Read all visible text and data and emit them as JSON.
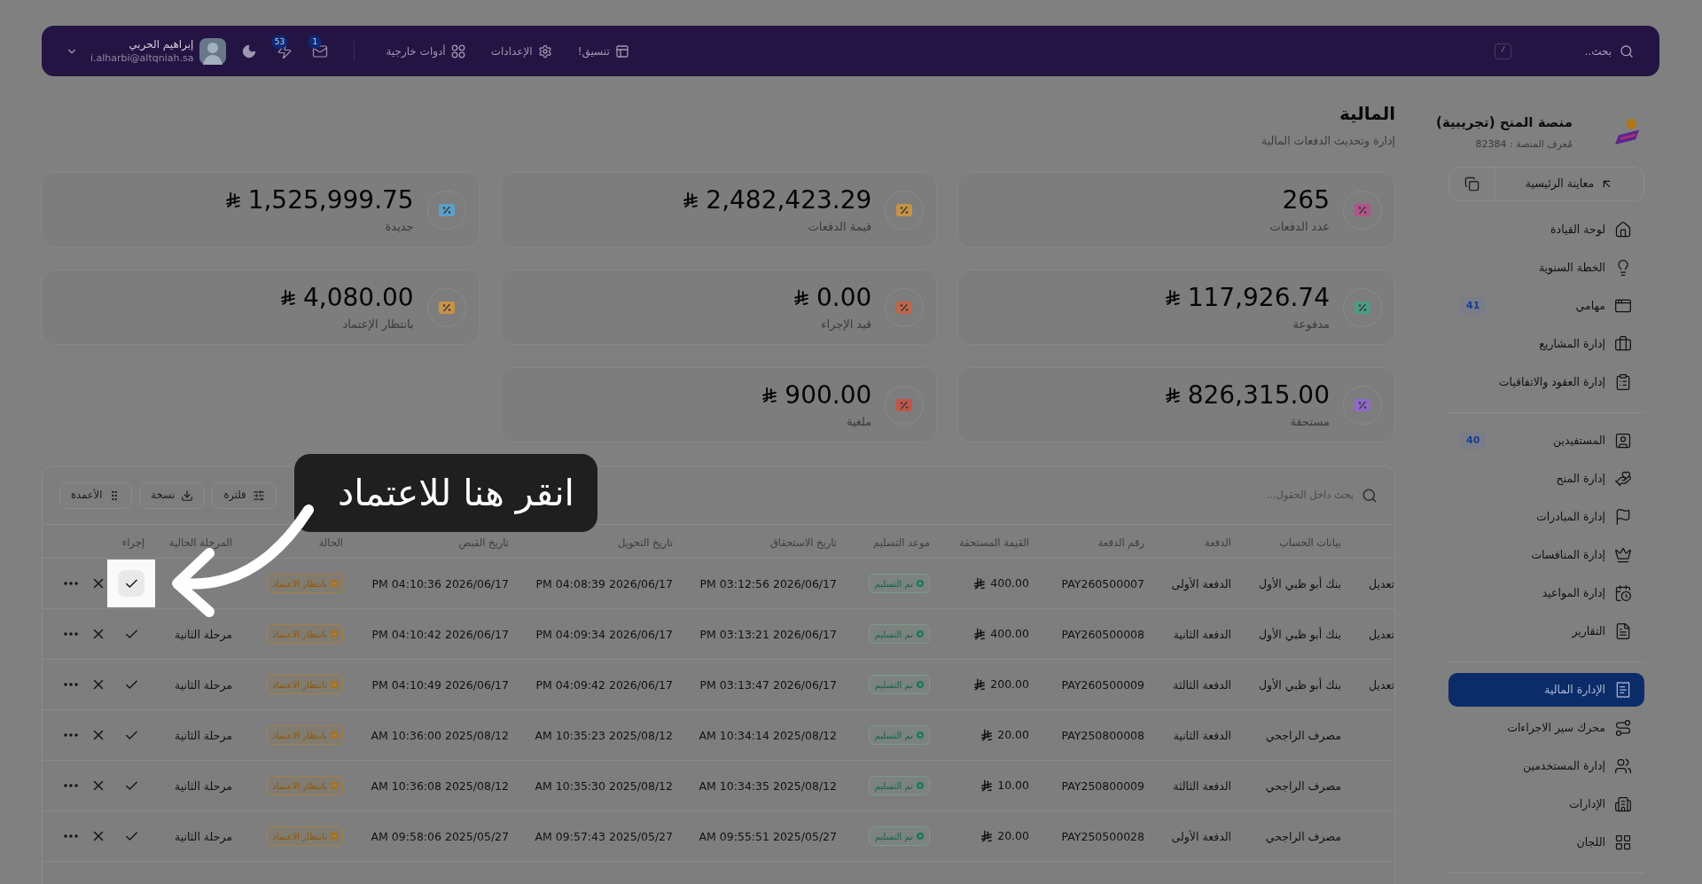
{
  "top_bar": {
    "search": {
      "placeholder": "بحث..",
      "shortcut": "/"
    },
    "links": [
      {
        "label": "تنسيق!"
      },
      {
        "label": "الإعدادات"
      },
      {
        "label": "أدوات خارجية"
      }
    ],
    "notifications": [
      {
        "count": "1"
      },
      {
        "count": "53"
      }
    ],
    "user": {
      "name": "إبراهيم الحربي",
      "email": "i.alharbi@altqniah.sa"
    }
  },
  "sidebar": {
    "platform": {
      "name": "منصة المنح (تجريبية)",
      "id_label": "مُعرف المنصة : 82384"
    },
    "preview_button": {
      "label": "معاينة الرئيسية"
    },
    "groups": [
      {
        "items": [
          {
            "label": "لوحة القيادة",
            "selected": false
          },
          {
            "label": "الخطة السنوية",
            "selected": false
          },
          {
            "label": "مهامي",
            "selected": false,
            "badge": "41"
          },
          {
            "label": "إدارة المشاريع",
            "selected": false
          },
          {
            "label": "إدارة العقود والاتفاقيات",
            "selected": false
          }
        ]
      },
      {
        "items": [
          {
            "label": "المستفيدين",
            "selected": false,
            "badge": "40"
          },
          {
            "label": "إدارة المنح",
            "selected": false
          },
          {
            "label": "إدارة المبادرات",
            "selected": false
          },
          {
            "label": "إدارة المنافسات",
            "selected": false
          },
          {
            "label": "إدارة المواعيد",
            "selected": false
          },
          {
            "label": "التقارير",
            "selected": false
          }
        ]
      },
      {
        "items": [
          {
            "label": "الإدارة المالية",
            "selected": true
          },
          {
            "label": "محرك سير الاجراءات",
            "selected": false
          },
          {
            "label": "إدارة المستخدمين",
            "selected": false
          },
          {
            "label": "الإدارات",
            "selected": false
          },
          {
            "label": "اللجان",
            "selected": false
          }
        ]
      }
    ]
  },
  "page": {
    "title": "المالية",
    "subtitle": "إدارة وتحديث الدفعات المالية"
  },
  "stats": [
    {
      "value": "265",
      "label": "عدد الدفعات",
      "currency": false
    },
    {
      "value": "2,482,423.29",
      "label": "قيمة الدفعات",
      "currency": true
    },
    {
      "value": "1,525,999.75",
      "label": "جديدة",
      "currency": true
    },
    {
      "value": "117,926.74",
      "label": "مدفوعة",
      "currency": true
    },
    {
      "value": "0.00",
      "label": "قيد الإجراء",
      "currency": true
    },
    {
      "value": "4,080.00",
      "label": "بانتظار الإعتماد",
      "currency": true
    },
    {
      "value": "826,315.00",
      "label": "مستحقة",
      "currency": true
    },
    {
      "value": "900.00",
      "label": "ملغية",
      "currency": true
    }
  ],
  "table": {
    "search": {
      "placeholder": "بحث داخل الحقول..."
    },
    "tools": [
      {
        "label": "فلترة"
      },
      {
        "label": "نسخة"
      },
      {
        "label": "الأعمدة"
      }
    ],
    "columns": [
      "بيانات الحساب",
      "الدفعة",
      "رقم الدفعة",
      "القيمة المستحقة",
      "موعد التسليم",
      "تاريخ الاستحقاق",
      "تاريخ التحويل",
      "تاريخ القبض",
      "الحالة",
      "المرحلة الحالية",
      "إجراء"
    ],
    "rows": [
      {
        "column_1": "تعديل",
        "account": "بنك أبو ظبي الأول",
        "installment": "الدفعة الأولى",
        "payment_number": "PAY260500007",
        "amount": "400.00",
        "delivery": "تم التسليم",
        "due_date": "PM 03:12:56 2026/06/17",
        "transfer_date": "PM 04:08:39 2026/06/17",
        "receipt_date": "PM 04:10:36 2026/06/17",
        "status": "بانتظار الاعتماد",
        "approve_highlighted": true
      },
      {
        "column_1": "تعديل",
        "account": "بنك أبو ظبي الأول",
        "installment": "الدفعة الثانية",
        "payment_number": "PAY260500008",
        "amount": "400.00",
        "delivery": "تم التسليم",
        "due_date": "PM 03:13:21 2026/06/17",
        "transfer_date": "PM 04:09:34 2026/06/17",
        "receipt_date": "PM 04:10:42 2026/06/17",
        "status": "بانتظار الاعتماد",
        "stage": "مرحلة الثانية",
        "approve_highlighted": false
      },
      {
        "column_1": "تعديل",
        "account": "بنك أبو ظبي الأول",
        "installment": "الدفعة الثالثة",
        "payment_number": "PAY260500009",
        "amount": "200.00",
        "delivery": "تم التسليم",
        "due_date": "PM 03:13:47 2026/06/17",
        "transfer_date": "PM 04:09:42 2026/06/17",
        "receipt_date": "PM 04:10:49 2026/06/17",
        "status": "بانتظار الاعتماد",
        "stage": "مرحلة الثانية",
        "approve_highlighted": false
      },
      {
        "account": "مصرف الراجحي",
        "installment": "الدفعة الثانية",
        "payment_number": "PAY250800008",
        "amount": "20.00",
        "delivery": "تم التسليم",
        "due_date": "AM 10:34:14 2025/08/12",
        "transfer_date": "AM 10:35:23 2025/08/12",
        "receipt_date": "AM 10:36:00 2025/08/12",
        "status": "بانتظار الاعتماد",
        "stage": "مرحلة الثانية",
        "approve_highlighted": false
      },
      {
        "account": "مصرف الراجحي",
        "installment": "الدفعة الثالثة",
        "payment_number": "PAY250800009",
        "amount": "10.00",
        "delivery": "تم التسليم",
        "due_date": "AM 10:34:35 2025/08/12",
        "transfer_date": "AM 10:35:30 2025/08/12",
        "receipt_date": "AM 10:36:08 2025/08/12",
        "status": "بانتظار الاعتماد",
        "stage": "مرحلة الثانية",
        "approve_highlighted": false
      },
      {
        "account": "مصرف الراجحي",
        "installment": "الدفعة الأولى",
        "payment_number": "PAY250500028",
        "amount": "20.00",
        "delivery": "تم التسليم",
        "due_date": "AM 09:55:51 2025/05/27",
        "transfer_date": "AM 09:57:43 2025/05/27",
        "receipt_date": "AM 09:58:06 2025/05/27",
        "status": "بانتظار الاعتماد",
        "stage": "مرحلة الثانية",
        "approve_highlighted": false
      }
    ]
  },
  "tour_tip": {
    "text": "انقر هنا للاعتماد"
  }
}
